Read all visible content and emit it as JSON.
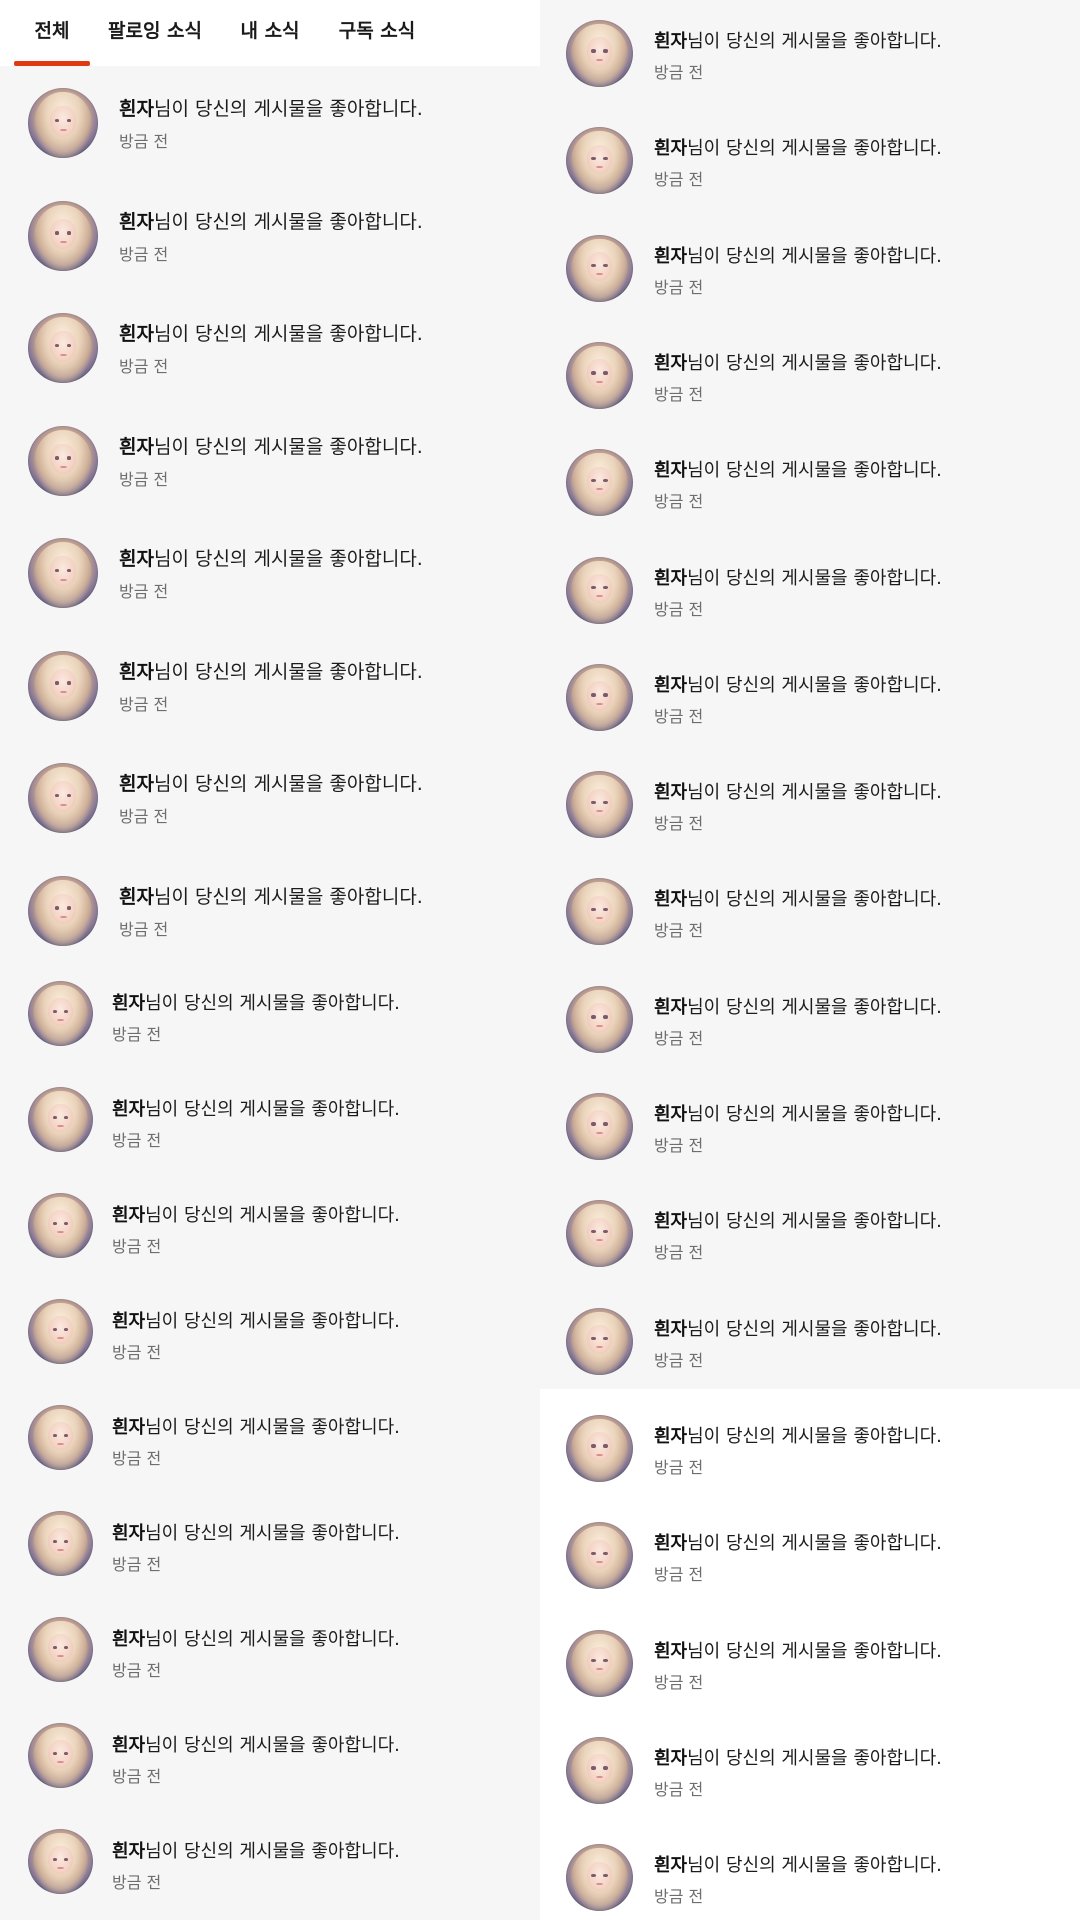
{
  "tabs": [
    {
      "label": "전체",
      "active": true
    },
    {
      "label": "팔로잉 소식",
      "active": false
    },
    {
      "label": "내 소식",
      "active": false
    },
    {
      "label": "구독 소식",
      "active": false
    }
  ],
  "colors": {
    "accent": "#e03a12",
    "background": "#f6f6f6",
    "tab_bar": "#ffffff",
    "time_text": "#6e6e6e"
  },
  "notification_template": {
    "nickname": "흰자",
    "message": "님이 당신의 게시물을 좋아합니다.",
    "time": "방금 전",
    "avatar_icon": "profile-avatar"
  },
  "left_notifications": [
    {
      "nickname": "흰자",
      "message": "님이 당신의 게시물을 좋아합니다.",
      "time": "방금 전"
    },
    {
      "nickname": "흰자",
      "message": "님이 당신의 게시물을 좋아합니다.",
      "time": "방금 전"
    },
    {
      "nickname": "흰자",
      "message": "님이 당신의 게시물을 좋아합니다.",
      "time": "방금 전"
    },
    {
      "nickname": "흰자",
      "message": "님이 당신의 게시물을 좋아합니다.",
      "time": "방금 전"
    },
    {
      "nickname": "흰자",
      "message": "님이 당신의 게시물을 좋아합니다.",
      "time": "방금 전"
    },
    {
      "nickname": "흰자",
      "message": "님이 당신의 게시물을 좋아합니다.",
      "time": "방금 전"
    },
    {
      "nickname": "흰자",
      "message": "님이 당신의 게시물을 좋아합니다.",
      "time": "방금 전"
    },
    {
      "nickname": "흰자",
      "message": "님이 당신의 게시물을 좋아합니다.",
      "time": "방금 전"
    },
    {
      "nickname": "흰자",
      "message": "님이 당신의 게시물을 좋아합니다.",
      "time": "방금 전"
    },
    {
      "nickname": "흰자",
      "message": "님이 당신의 게시물을 좋아합니다.",
      "time": "방금 전"
    },
    {
      "nickname": "흰자",
      "message": "님이 당신의 게시물을 좋아합니다.",
      "time": "방금 전"
    },
    {
      "nickname": "흰자",
      "message": "님이 당신의 게시물을 좋아합니다.",
      "time": "방금 전"
    },
    {
      "nickname": "흰자",
      "message": "님이 당신의 게시물을 좋아합니다.",
      "time": "방금 전"
    },
    {
      "nickname": "흰자",
      "message": "님이 당신의 게시물을 좋아합니다.",
      "time": "방금 전"
    },
    {
      "nickname": "흰자",
      "message": "님이 당신의 게시물을 좋아합니다.",
      "time": "방금 전"
    },
    {
      "nickname": "흰자",
      "message": "님이 당신의 게시물을 좋아합니다.",
      "time": "방금 전"
    },
    {
      "nickname": "흰자",
      "message": "님이 당신의 게시물을 좋아합니다.",
      "time": "방금 전"
    }
  ],
  "right_notifications": [
    {
      "nickname": "흰자",
      "message": "님이 당신의 게시물을 좋아합니다.",
      "time": "방금 전"
    },
    {
      "nickname": "흰자",
      "message": "님이 당신의 게시물을 좋아합니다.",
      "time": "방금 전"
    },
    {
      "nickname": "흰자",
      "message": "님이 당신의 게시물을 좋아합니다.",
      "time": "방금 전"
    },
    {
      "nickname": "흰자",
      "message": "님이 당신의 게시물을 좋아합니다.",
      "time": "방금 전"
    },
    {
      "nickname": "흰자",
      "message": "님이 당신의 게시물을 좋아합니다.",
      "time": "방금 전"
    },
    {
      "nickname": "흰자",
      "message": "님이 당신의 게시물을 좋아합니다.",
      "time": "방금 전"
    },
    {
      "nickname": "흰자",
      "message": "님이 당신의 게시물을 좋아합니다.",
      "time": "방금 전"
    },
    {
      "nickname": "흰자",
      "message": "님이 당신의 게시물을 좋아합니다.",
      "time": "방금 전"
    },
    {
      "nickname": "흰자",
      "message": "님이 당신의 게시물을 좋아합니다.",
      "time": "방금 전"
    },
    {
      "nickname": "흰자",
      "message": "님이 당신의 게시물을 좋아합니다.",
      "time": "방금 전"
    },
    {
      "nickname": "흰자",
      "message": "님이 당신의 게시물을 좋아합니다.",
      "time": "방금 전"
    },
    {
      "nickname": "흰자",
      "message": "님이 당신의 게시물을 좋아합니다.",
      "time": "방금 전"
    },
    {
      "nickname": "흰자",
      "message": "님이 당신의 게시물을 좋아합니다.",
      "time": "방금 전"
    },
    {
      "nickname": "흰자",
      "message": "님이 당신의 게시물을 좋아합니다.",
      "time": "방금 전"
    },
    {
      "nickname": "흰자",
      "message": "님이 당신의 게시물을 좋아합니다.",
      "time": "방금 전"
    },
    {
      "nickname": "흰자",
      "message": "님이 당신의 게시물을 좋아합니다.",
      "time": "방금 전"
    },
    {
      "nickname": "흰자",
      "message": "님이 당신의 게시물을 좋아합니다.",
      "time": "방금 전"
    },
    {
      "nickname": "흰자",
      "message": "님이 당신의 게시물을 좋아합니다.",
      "time": "방금 전"
    }
  ]
}
